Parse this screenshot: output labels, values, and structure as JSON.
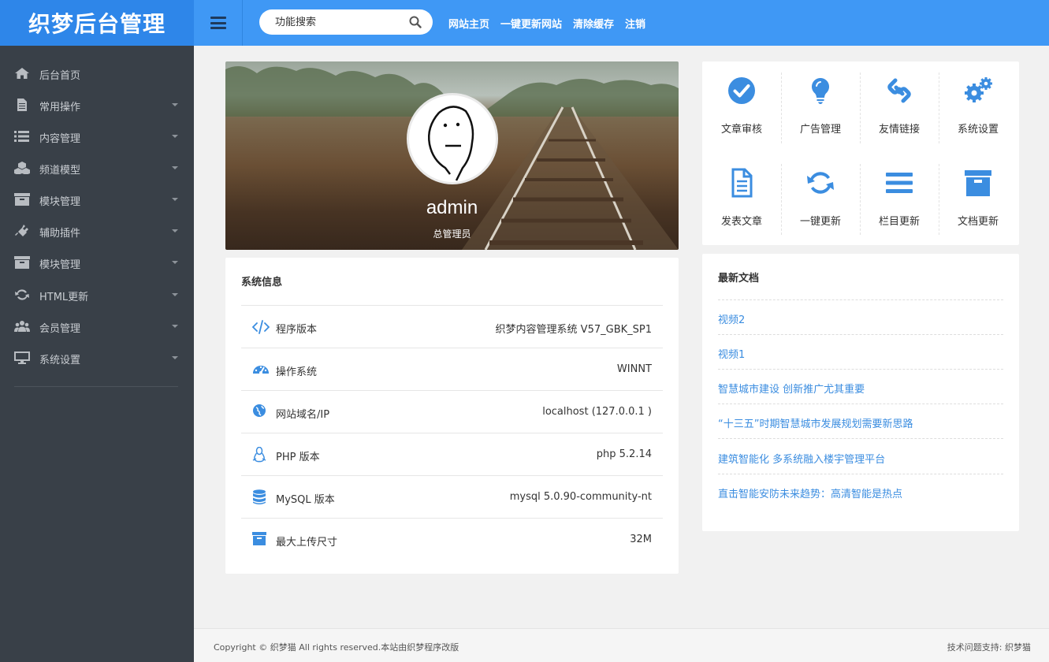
{
  "app": {
    "logo_text": "织梦后台管理"
  },
  "header": {
    "search_placeholder": "功能搜索",
    "links": [
      "网站主页",
      "一键更新网站",
      "清除缓存",
      "注销"
    ]
  },
  "sidebar": {
    "items": [
      {
        "label": "后台首页",
        "icon": "home-icon",
        "has_caret": false
      },
      {
        "label": "常用操作",
        "icon": "document-icon",
        "has_caret": true
      },
      {
        "label": "内容管理",
        "icon": "list-icon",
        "has_caret": true
      },
      {
        "label": "频道模型",
        "icon": "cubes-icon",
        "has_caret": true
      },
      {
        "label": "模块管理",
        "icon": "archive-icon",
        "has_caret": true
      },
      {
        "label": "辅助插件",
        "icon": "plug-icon",
        "has_caret": true
      },
      {
        "label": "模块管理",
        "icon": "archive-icon",
        "has_caret": true
      },
      {
        "label": "HTML更新",
        "icon": "refresh-icon",
        "has_caret": true
      },
      {
        "label": "会员管理",
        "icon": "users-icon",
        "has_caret": true
      },
      {
        "label": "系统设置",
        "icon": "desktop-icon",
        "has_caret": true
      }
    ]
  },
  "profile": {
    "name": "admin",
    "role": "总管理员"
  },
  "quick_actions": [
    {
      "label": "文章审核",
      "icon": "check-circle-icon"
    },
    {
      "label": "广告管理",
      "icon": "lightbulb-icon"
    },
    {
      "label": "友情链接",
      "icon": "link-icon"
    },
    {
      "label": "系统设置",
      "icon": "gears-icon"
    },
    {
      "label": "发表文章",
      "icon": "file-text-icon"
    },
    {
      "label": "一键更新",
      "icon": "refresh-icon"
    },
    {
      "label": "栏目更新",
      "icon": "bars-icon"
    },
    {
      "label": "文档更新",
      "icon": "archive-icon"
    }
  ],
  "system_info": {
    "title": "系统信息",
    "rows": [
      {
        "key": "程序版本",
        "value": "织梦内容管理系统 V57_GBK_SP1",
        "icon": "code-icon"
      },
      {
        "key": "操作系统",
        "value": "WINNT",
        "icon": "dashboard-icon"
      },
      {
        "key": "网站域名/IP",
        "value": "localhost (127.0.0.1 )",
        "icon": "globe-icon"
      },
      {
        "key": "PHP 版本",
        "value": "php 5.2.14",
        "icon": "linux-icon"
      },
      {
        "key": "MySQL 版本",
        "value": "mysql 5.0.90-community-nt",
        "icon": "database-icon"
      },
      {
        "key": "最大上传尺寸",
        "value": "32M",
        "icon": "archive-icon"
      }
    ]
  },
  "latest_docs": {
    "title": "最新文档",
    "items": [
      "视频2",
      "视频1",
      "智慧城市建设 创新推广尤其重要",
      "“十三五”时期智慧城市发展规划需要新思路",
      "建筑智能化 多系统融入楼宇管理平台",
      "直击智能安防未来趋势：高清智能是热点"
    ]
  },
  "footer": {
    "copyright": "Copyright © 织梦猫 All rights reserved.本站由织梦程序改版",
    "support": "技术问题支持: 织梦猫"
  },
  "colors": {
    "topbar": "#3f98f5",
    "logo_bg": "#2e86e9",
    "sidebar": "#394048",
    "accent": "#3b8de0"
  }
}
